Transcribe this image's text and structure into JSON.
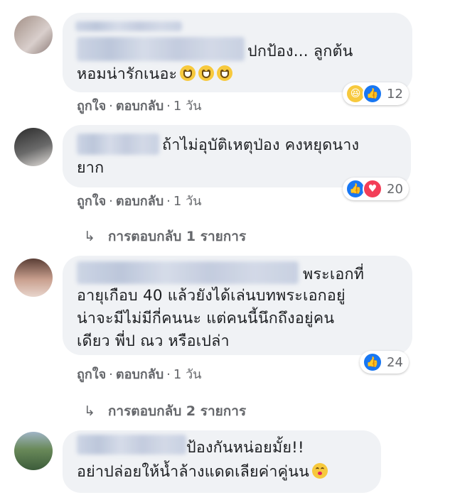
{
  "comments": [
    {
      "text_lines": [
        "ปกป้อง... ลูกต้น",
        "หอมน่ารักเนอะ"
      ],
      "emoji_names": [
        "grinning-face-icon",
        "grinning-face-icon",
        "grinning-face-icon"
      ],
      "actions": {
        "like": "ถูกใจ",
        "reply": "ตอบกลับ",
        "time": "1 วัน"
      },
      "reactions": {
        "icons": [
          "haha-reaction-icon",
          "like-reaction-icon"
        ],
        "count": "12"
      }
    },
    {
      "text_lines": [
        "ถ้าไม่อุบัติเหตุป่อง คงหยุดนาง",
        "ยาก"
      ],
      "actions": {
        "like": "ถูกใจ",
        "reply": "ตอบกลับ",
        "time": "1 วัน"
      },
      "reactions": {
        "icons": [
          "like-reaction-icon",
          "love-reaction-icon"
        ],
        "count": "20"
      },
      "replies_label": "การตอบกลับ 1 รายการ"
    },
    {
      "text_lines": [
        "พระเอกที่",
        "อายุเกือบ 40 แล้วยังได้เล่นบทพระเอกอยู่",
        "น่าจะมีไม่มีกี่คนนะ แต่คนนี้นึกถึงอยู่คน",
        "เดียว พี่ป ณว หรือเปล่า"
      ],
      "actions": {
        "like": "ถูกใจ",
        "reply": "ตอบกลับ",
        "time": "1 วัน"
      },
      "reactions": {
        "icons": [
          "like-reaction-icon"
        ],
        "count": "24"
      },
      "replies_label": "การตอบกลับ 2 รายการ"
    },
    {
      "text_lines": [
        "ป้องกันหน่อยมั้ย!!",
        "อย่าปล่อยให้น้ำล้างแดดเลียค่าคู่นน"
      ],
      "emoji_names": [
        "kissing-heart-face-icon"
      ]
    }
  ],
  "icons": {
    "reply_arrow": "↳",
    "separator": "·"
  },
  "colors": {
    "bubble": "#f0f2f5",
    "like": "#1877f2",
    "love": "#f33e58",
    "haha": "#f7c93d",
    "meta": "#65676b"
  }
}
